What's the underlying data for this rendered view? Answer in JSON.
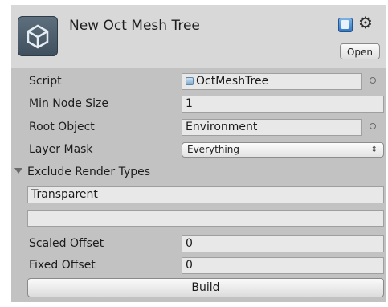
{
  "header": {
    "title": "New Oct Mesh Tree",
    "open_label": "Open",
    "icons": [
      "unity-logo-icon",
      "book-icon",
      "gear-icon"
    ]
  },
  "properties": {
    "script": {
      "label": "Script",
      "value": "OctMeshTree"
    },
    "min_node_size": {
      "label": "Min Node Size",
      "value": "1"
    },
    "root_object": {
      "label": "Root Object",
      "value": "Environment"
    },
    "layer_mask": {
      "label": "Layer Mask",
      "value": "Everything"
    },
    "exclude_render_types": {
      "label": "Exclude Render Types",
      "expanded": true,
      "items": [
        "Transparent",
        ""
      ]
    },
    "scaled_offset": {
      "label": "Scaled Offset",
      "value": "0"
    },
    "fixed_offset": {
      "label": "Fixed Offset",
      "value": "0"
    }
  },
  "build_label": "Build",
  "colors": {
    "panel_bg": "#c2c2c2",
    "header_bg": "#d8d8d8",
    "field_bg": "#e8e8e8"
  }
}
